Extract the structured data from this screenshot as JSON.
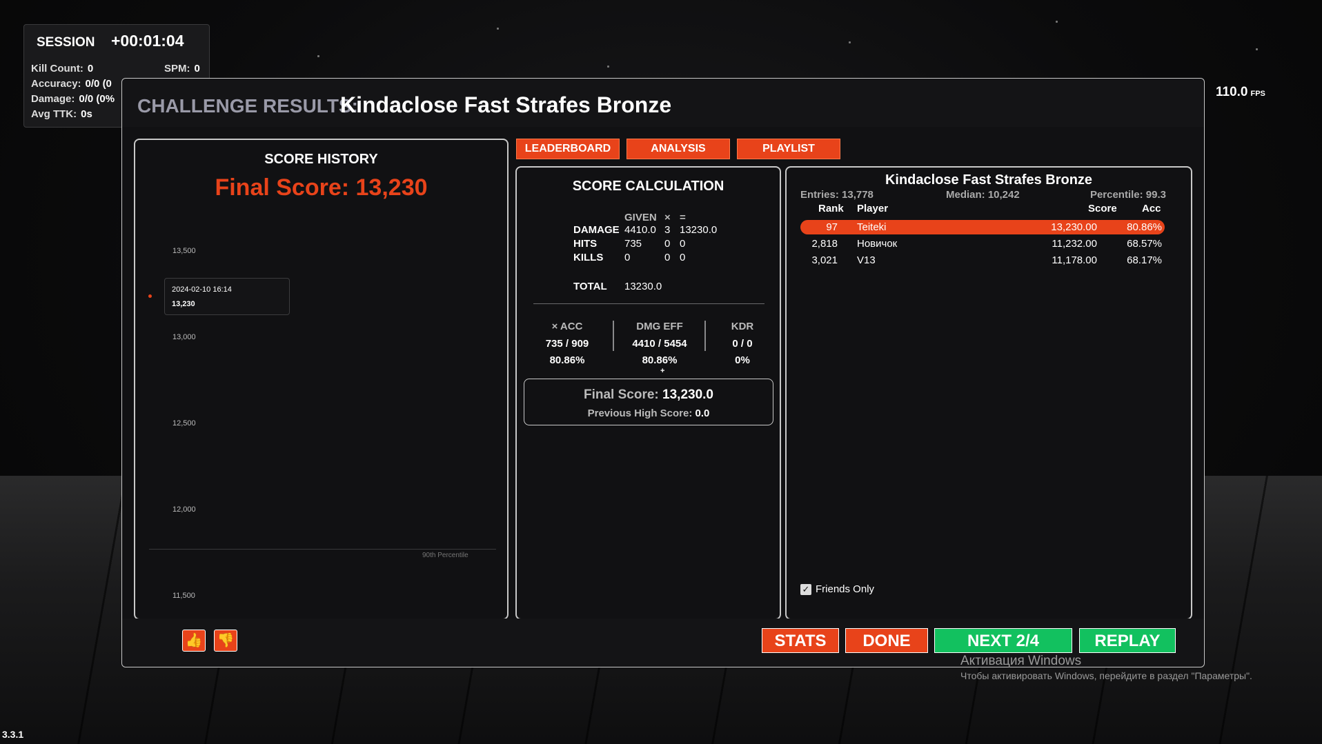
{
  "session": {
    "label": "SESSION",
    "time": "+00:01:04",
    "kill_count_label": "Kill Count:",
    "kill_count": "0",
    "spm_label": "SPM:",
    "spm": "0",
    "accuracy_label": "Accuracy:",
    "accuracy": "0/0 (0",
    "damage_label": "Damage:",
    "damage": "0/0 (0%",
    "avg_ttk_label": "Avg TTK:",
    "avg_ttk": "0s"
  },
  "fps": {
    "value": "110.0",
    "unit": "FPS"
  },
  "version": "3.3.1",
  "dialog": {
    "title_prefix": "CHALLENGE RESULTS:",
    "challenge_name": "Kindaclose Fast Strafes Bronze"
  },
  "score_history": {
    "title": "SCORE HISTORY",
    "final_score": "Final Score: 13,230",
    "ticks": [
      "13,500",
      "13,000",
      "12,500",
      "12,000",
      "11,500"
    ],
    "percentile_label": "90th Percentile",
    "tooltip": {
      "date": "2024-02-10 16:14",
      "value": "13,230"
    }
  },
  "chart_data": {
    "type": "scatter",
    "title": "SCORE HISTORY",
    "x": [
      "2024-02-10 16:14"
    ],
    "values": [
      13230
    ],
    "ylim": [
      11500,
      13500
    ],
    "yticks": [
      13500,
      13000,
      12500,
      12000,
      11500
    ]
  },
  "tabs": {
    "leaderboard": "LEADERBOARD",
    "analysis": "ANALYSIS",
    "playlist": "PLAYLIST"
  },
  "calc": {
    "title": "SCORE CALCULATION",
    "header": {
      "given": "GIVEN",
      "times": "×",
      "equals": "="
    },
    "rows": [
      {
        "label": "DAMAGE",
        "given": "4410.0",
        "mult": "3",
        "result": "13230.0"
      },
      {
        "label": "HITS",
        "given": "735",
        "mult": "0",
        "result": "0"
      },
      {
        "label": "KILLS",
        "given": "0",
        "mult": "0",
        "result": "0"
      }
    ],
    "total_label": "TOTAL",
    "total": "13230.0",
    "stats": [
      {
        "label": "× ACC",
        "ratio": "735 / 909",
        "pct": "80.86%"
      },
      {
        "label": "DMG EFF",
        "ratio": "4410 / 5454",
        "pct": "80.86%"
      },
      {
        "label": "KDR",
        "ratio": "0 / 0",
        "pct": "0%"
      }
    ],
    "plus": "+",
    "final_label": "Final Score:",
    "final_value": "13,230.0",
    "prev_label": "Previous High Score:",
    "prev_value": "0.0"
  },
  "leaderboard": {
    "title": "Kindaclose Fast Strafes Bronze",
    "entries": "Entries: 13,778",
    "median": "Median: 10,242",
    "percentile": "Percentile: 99.3",
    "headers": {
      "rank": "Rank",
      "player": "Player",
      "score": "Score",
      "acc": "Acc"
    },
    "rows": [
      {
        "rank": "97",
        "player": "Teiteki",
        "score": "13,230.00",
        "acc": "80.86%"
      },
      {
        "rank": "2,818",
        "player": "Новичок",
        "score": "11,232.00",
        "acc": "68.57%"
      },
      {
        "rank": "3,021",
        "player": "V13",
        "score": "11,178.00",
        "acc": "68.17%"
      }
    ],
    "friends_only": "Friends Only"
  },
  "buttons": {
    "stats": "STATS",
    "done": "DONE",
    "next": "NEXT 2/4",
    "replay": "REPLAY"
  },
  "windows": {
    "line1": "Активация Windows",
    "line2": "Чтобы активировать Windows, перейдите в раздел \"Параметры\"."
  },
  "colors": {
    "accent": "#e8431a",
    "green": "#12c15f"
  }
}
